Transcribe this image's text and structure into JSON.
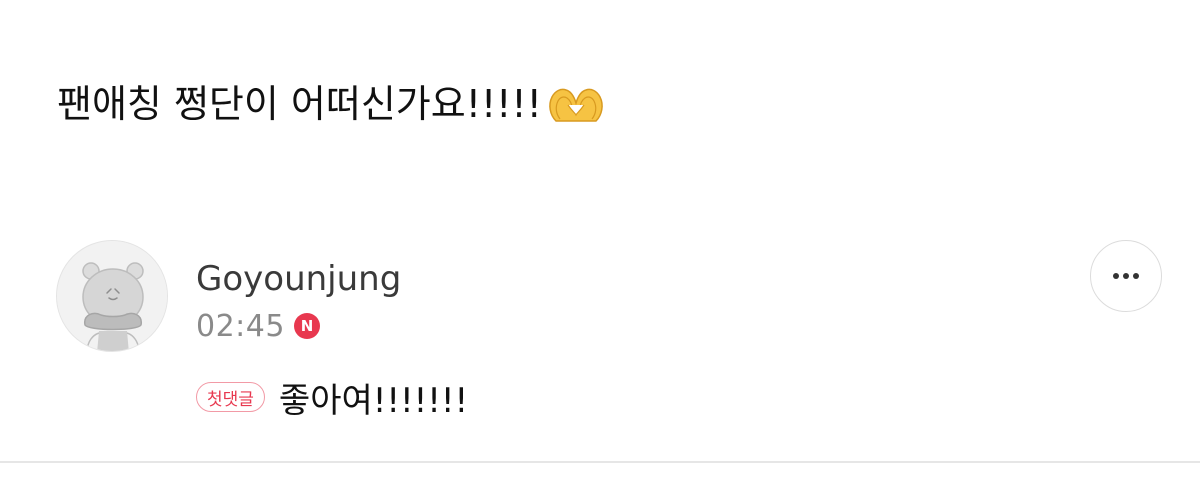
{
  "post": {
    "title": "팬애칭 쩡단이 어떠신가요!!!!!",
    "title_emoji": "heart-hands-icon"
  },
  "comment": {
    "author": "Goyounjung",
    "time": "02:45",
    "new_badge": "N",
    "first_comment_badge": "첫댓글",
    "text": "좋아여!!!!!!!",
    "more_icon": "more-horizontal-icon"
  },
  "colors": {
    "accent_red": "#e8384f",
    "badge_border": "#f29aa6",
    "text_primary": "#111111",
    "text_secondary": "#8a8a8a"
  }
}
